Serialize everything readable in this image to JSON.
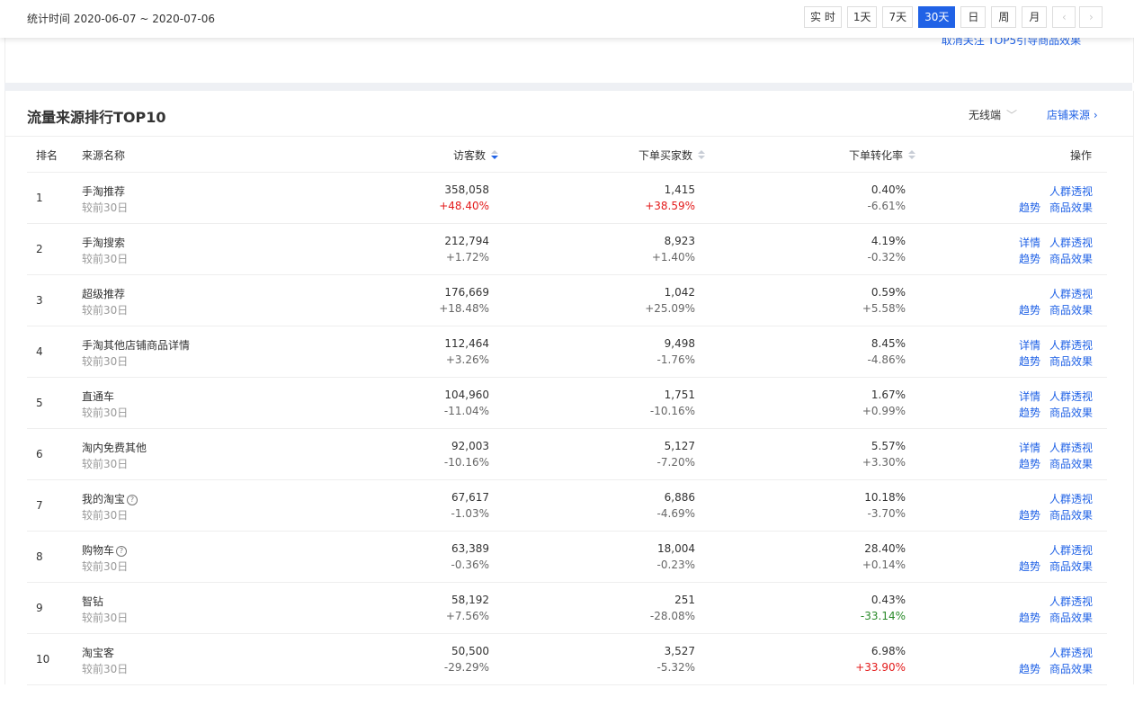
{
  "header": {
    "date_range": "统计时间 2020-06-07 ~ 2020-07-06",
    "periods": [
      "实 时",
      "1天",
      "7天",
      "30天",
      "日",
      "周",
      "月"
    ],
    "active_period": "30天"
  },
  "upper_panel": {
    "collapse_text": "取消关注 TOP5引导商品效果 ˅"
  },
  "panel": {
    "title": "流量来源排行TOP10",
    "device_select": "无线端",
    "store_source_link": "店铺来源 ›"
  },
  "table": {
    "headers": {
      "rank": "排名",
      "name": "来源名称",
      "visitors": "访客数",
      "buyers": "下单买家数",
      "conversion": "下单转化率",
      "actions": "操作"
    },
    "compare_label": "较前30日",
    "action_labels": {
      "detail": "详情",
      "crowd": "人群透视",
      "trend": "趋势",
      "goods": "商品效果"
    },
    "rows": [
      {
        "rank": "1",
        "name": "手淘推荐",
        "help": false,
        "visitors": "358,058",
        "visitors_chg": "+48.40%",
        "visitors_color": "red",
        "buyers": "1,415",
        "buyers_chg": "+38.59%",
        "buyers_color": "red",
        "conv": "0.40%",
        "conv_chg": "-6.61%",
        "conv_color": "gray",
        "detail": false
      },
      {
        "rank": "2",
        "name": "手淘搜索",
        "help": false,
        "visitors": "212,794",
        "visitors_chg": "+1.72%",
        "visitors_color": "gray",
        "buyers": "8,923",
        "buyers_chg": "+1.40%",
        "buyers_color": "gray",
        "conv": "4.19%",
        "conv_chg": "-0.32%",
        "conv_color": "gray",
        "detail": true
      },
      {
        "rank": "3",
        "name": "超级推荐",
        "help": false,
        "visitors": "176,669",
        "visitors_chg": "+18.48%",
        "visitors_color": "gray",
        "buyers": "1,042",
        "buyers_chg": "+25.09%",
        "buyers_color": "gray",
        "conv": "0.59%",
        "conv_chg": "+5.58%",
        "conv_color": "gray",
        "detail": false
      },
      {
        "rank": "4",
        "name": "手淘其他店铺商品详情",
        "help": false,
        "visitors": "112,464",
        "visitors_chg": "+3.26%",
        "visitors_color": "gray",
        "buyers": "9,498",
        "buyers_chg": "-1.76%",
        "buyers_color": "gray",
        "conv": "8.45%",
        "conv_chg": "-4.86%",
        "conv_color": "gray",
        "detail": true
      },
      {
        "rank": "5",
        "name": "直通车",
        "help": false,
        "visitors": "104,960",
        "visitors_chg": "-11.04%",
        "visitors_color": "gray",
        "buyers": "1,751",
        "buyers_chg": "-10.16%",
        "buyers_color": "gray",
        "conv": "1.67%",
        "conv_chg": "+0.99%",
        "conv_color": "gray",
        "detail": true
      },
      {
        "rank": "6",
        "name": "淘内免费其他",
        "help": false,
        "visitors": "92,003",
        "visitors_chg": "-10.16%",
        "visitors_color": "gray",
        "buyers": "5,127",
        "buyers_chg": "-7.20%",
        "buyers_color": "gray",
        "conv": "5.57%",
        "conv_chg": "+3.30%",
        "conv_color": "gray",
        "detail": true
      },
      {
        "rank": "7",
        "name": "我的淘宝",
        "help": true,
        "visitors": "67,617",
        "visitors_chg": "-1.03%",
        "visitors_color": "gray",
        "buyers": "6,886",
        "buyers_chg": "-4.69%",
        "buyers_color": "gray",
        "conv": "10.18%",
        "conv_chg": "-3.70%",
        "conv_color": "gray",
        "detail": false
      },
      {
        "rank": "8",
        "name": "购物车",
        "help": true,
        "visitors": "63,389",
        "visitors_chg": "-0.36%",
        "visitors_color": "gray",
        "buyers": "18,004",
        "buyers_chg": "-0.23%",
        "buyers_color": "gray",
        "conv": "28.40%",
        "conv_chg": "+0.14%",
        "conv_color": "gray",
        "detail": false
      },
      {
        "rank": "9",
        "name": "智钻",
        "help": false,
        "visitors": "58,192",
        "visitors_chg": "+7.56%",
        "visitors_color": "gray",
        "buyers": "251",
        "buyers_chg": "-28.08%",
        "buyers_color": "gray",
        "conv": "0.43%",
        "conv_chg": "-33.14%",
        "conv_color": "green",
        "detail": false
      },
      {
        "rank": "10",
        "name": "淘宝客",
        "help": false,
        "visitors": "50,500",
        "visitors_chg": "-29.29%",
        "visitors_color": "gray",
        "buyers": "3,527",
        "buyers_chg": "-5.32%",
        "buyers_color": "gray",
        "conv": "6.98%",
        "conv_chg": "+33.90%",
        "conv_color": "red",
        "detail": false
      }
    ]
  },
  "colors": {
    "accent": "#2062e6",
    "up": "#e31b1b",
    "down": "#2a8a2a",
    "muted": "#999999"
  }
}
